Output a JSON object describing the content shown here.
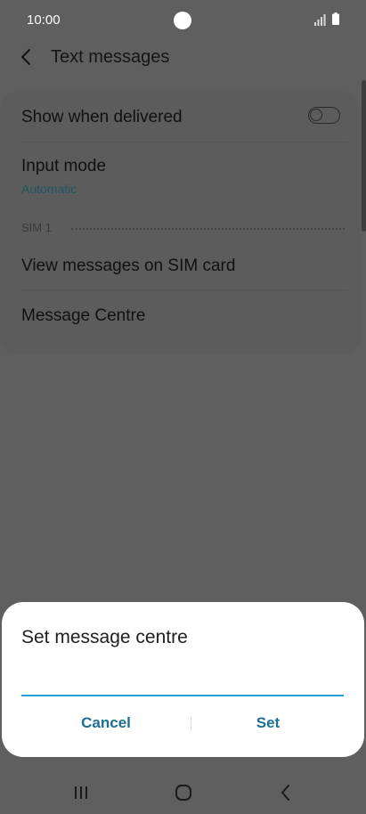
{
  "status_bar": {
    "time": "10:00",
    "icons": [
      "camera-hole",
      "signal-icon",
      "battery-icon"
    ]
  },
  "header": {
    "back_icon": "back-arrow-icon",
    "title": "Text messages"
  },
  "settings": {
    "show_when_delivered": {
      "label": "Show when delivered",
      "toggle_on": false
    },
    "input_mode": {
      "label": "Input mode",
      "value": "Automatic"
    },
    "section_label": "SIM 1",
    "view_messages": {
      "label": "View messages on SIM card"
    },
    "message_centre": {
      "label": "Message Centre"
    }
  },
  "dialog": {
    "title": "Set message centre",
    "input_value": "",
    "cancel_label": "Cancel",
    "set_label": "Set"
  },
  "nav_bar": {
    "icons": [
      "recents-icon",
      "home-icon",
      "back-icon"
    ]
  },
  "colors": {
    "accent": "#2a9fd6",
    "button_text": "#1b6f94",
    "dim_background": "#5f5f5f"
  }
}
